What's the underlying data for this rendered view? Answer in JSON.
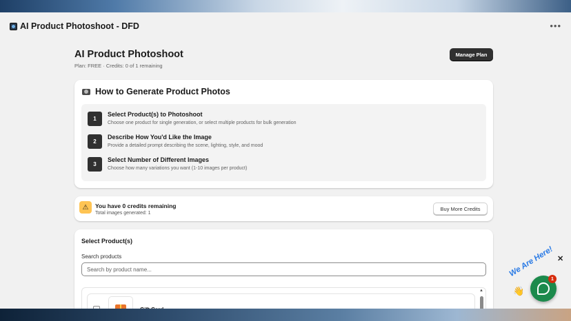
{
  "app": {
    "title": "AI Product Photoshoot - DFD",
    "more_icon": "ellipsis-icon"
  },
  "header": {
    "title": "AI Product Photoshoot",
    "plan_info": "Plan: FREE · Credits: 0 of 1 remaining",
    "manage_plan_label": "Manage Plan"
  },
  "how_to": {
    "title": "How to Generate Product Photos",
    "icon": "camera-icon",
    "steps": [
      {
        "number": "1",
        "title": "Select Product(s) to Photoshoot",
        "description": "Choose one product for single generation, or select multiple products for bulk generation"
      },
      {
        "number": "2",
        "title": "Describe How You'd Like the Image",
        "description": "Provide a detailed prompt describing the scene, lighting, style, and mood"
      },
      {
        "number": "3",
        "title": "Select Number of Different Images",
        "description": "Choose how many variations you want (1-10 images per product)"
      }
    ]
  },
  "credits": {
    "icon": "warning-icon",
    "title": "You have 0 credits remaining",
    "subtitle": "Total images generated: 1",
    "buy_label": "Buy More Credits"
  },
  "products": {
    "title": "Select Product(s)",
    "search_label": "Search products",
    "search_placeholder": "Search by product name...",
    "search_value": "",
    "items": [
      {
        "name": "Gift Card",
        "checked": false
      }
    ]
  },
  "chat_widget": {
    "greeting": "We Are Here!",
    "badge_count": "1",
    "close_label": "✕"
  },
  "colors": {
    "primary_button": "#303030",
    "warning": "#ffc453",
    "chat": "#1c8a4c",
    "badge": "#d72c0d",
    "greeting": "#2b7be5"
  }
}
